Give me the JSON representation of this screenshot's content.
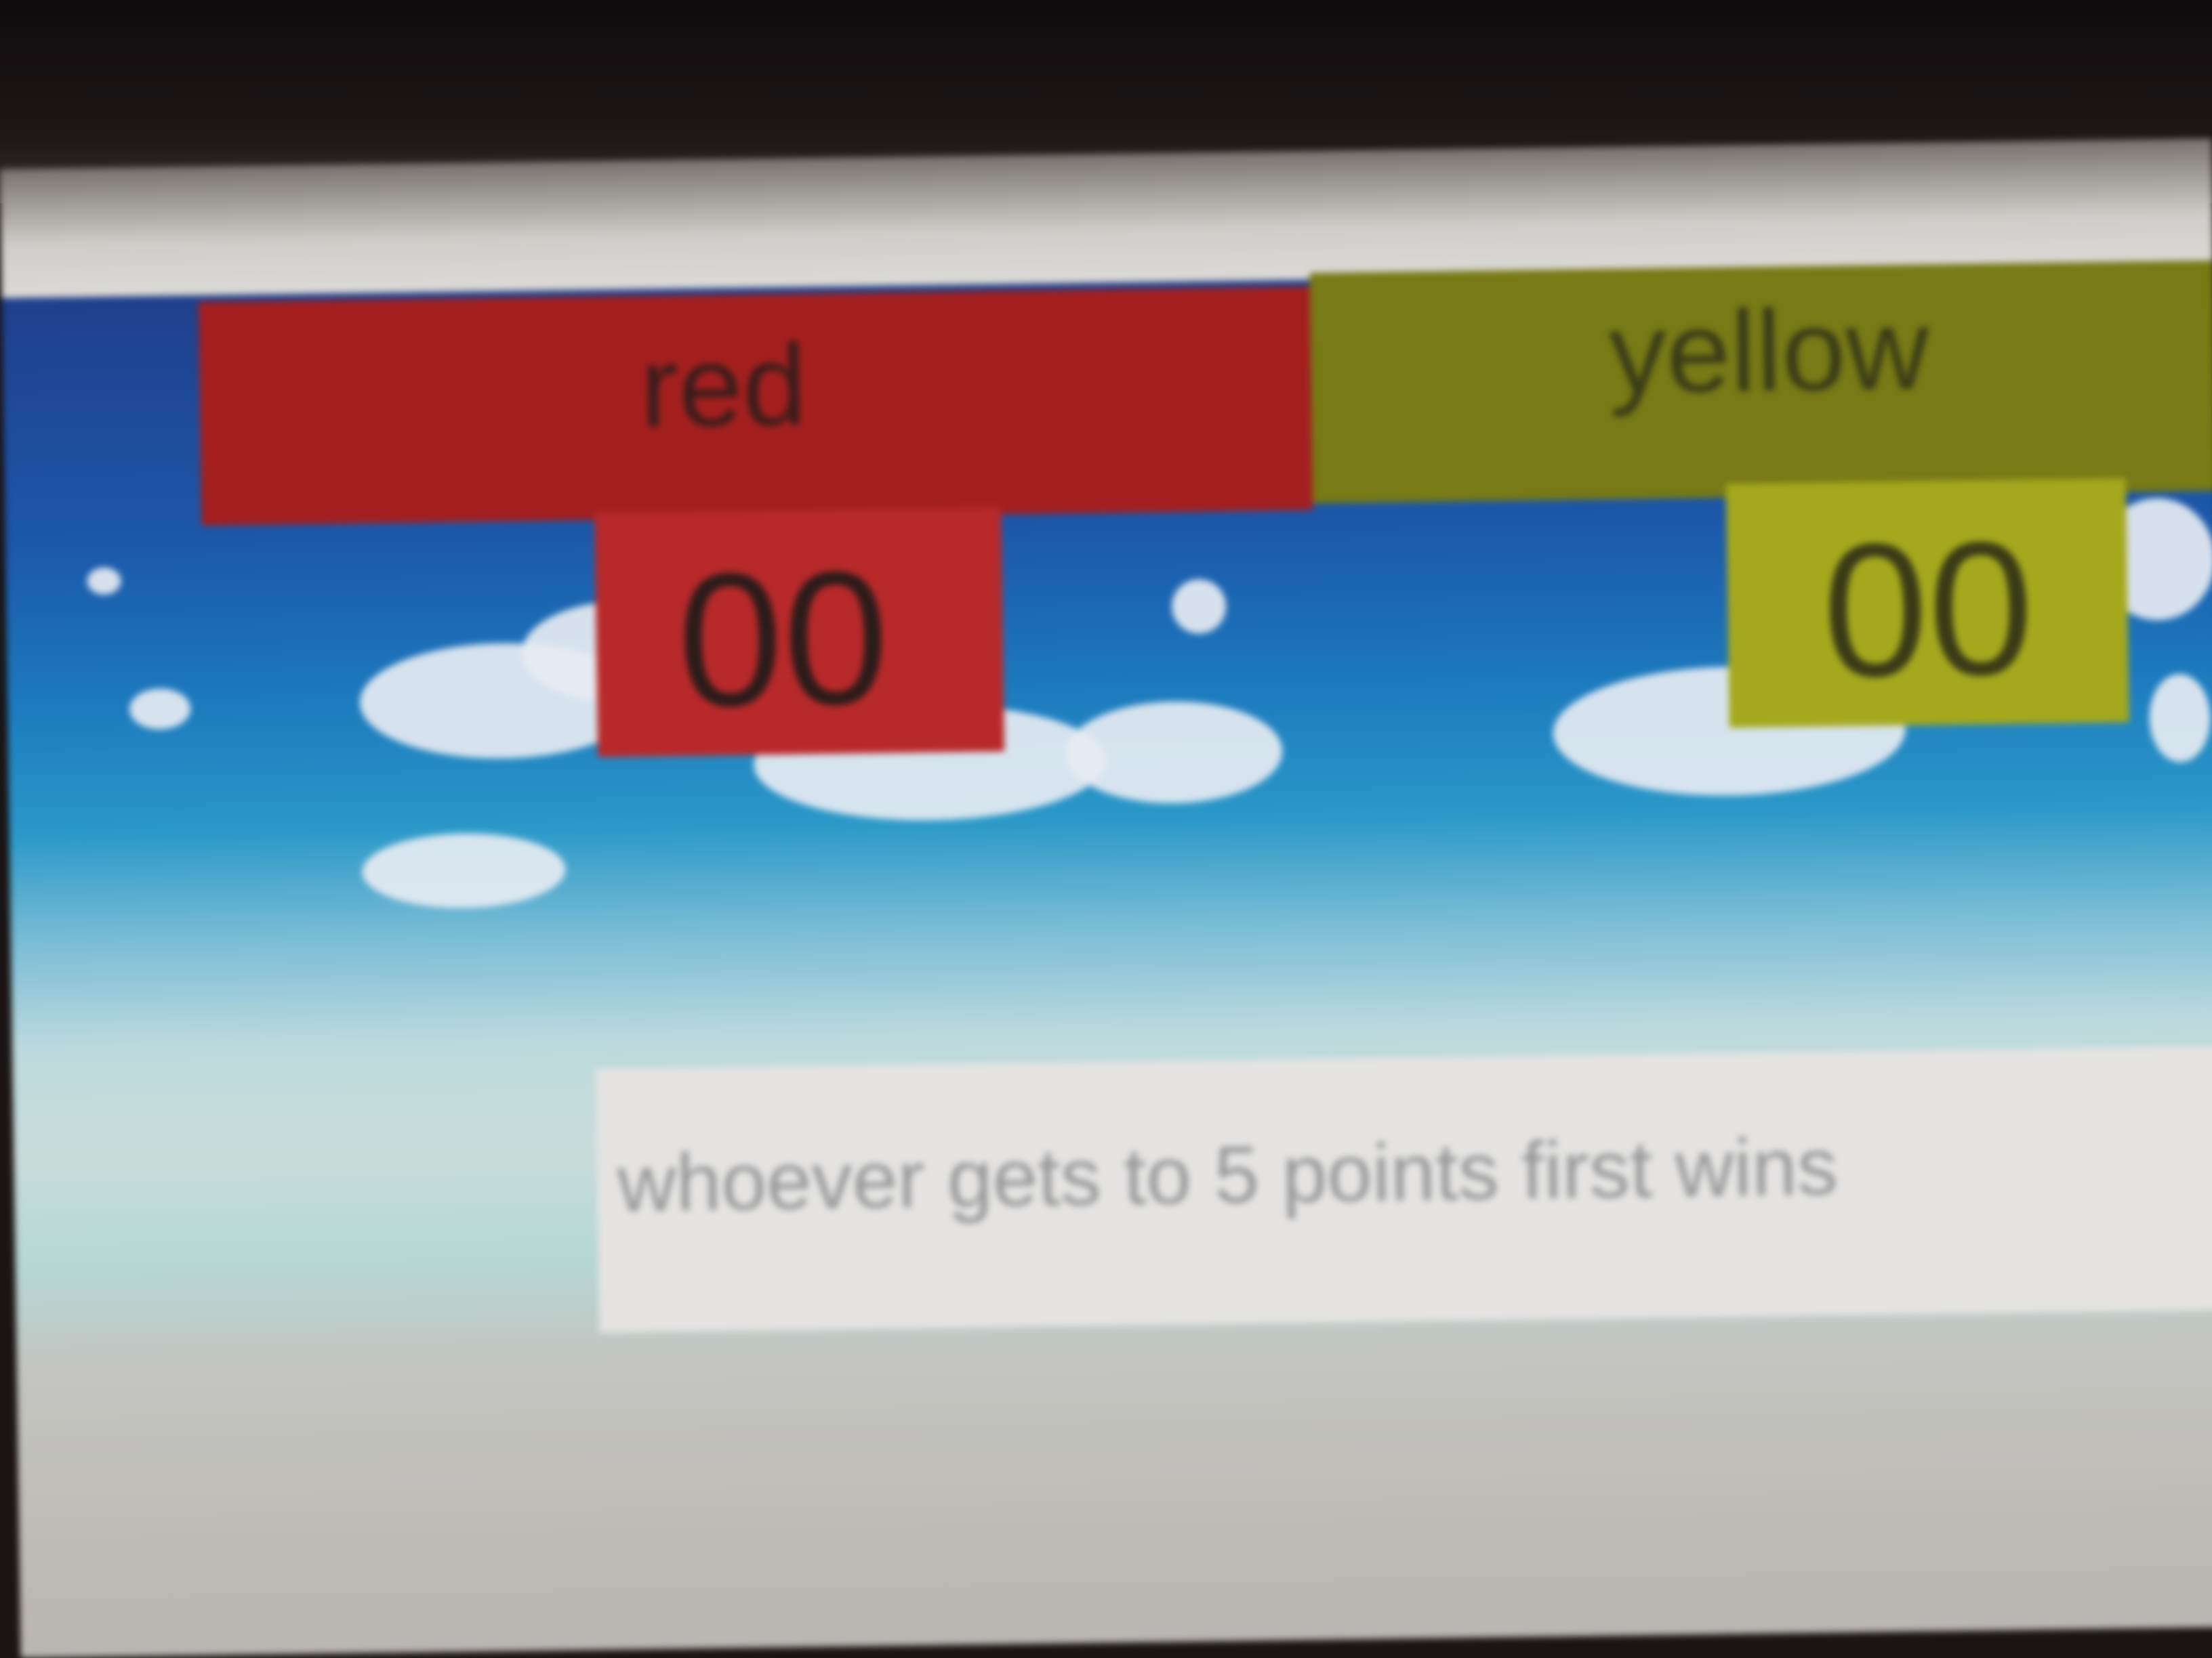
{
  "scoreboard": {
    "red": {
      "label": "red",
      "score": "00",
      "color": "#b8292a"
    },
    "yellow": {
      "label": "yellow",
      "score": "00",
      "color": "#a4a81c"
    }
  },
  "message": {
    "text": "whoever gets to 5 points first wins"
  },
  "background": {
    "sky_color": "#1c79bd",
    "cloud_color": "#e6ecf2"
  }
}
